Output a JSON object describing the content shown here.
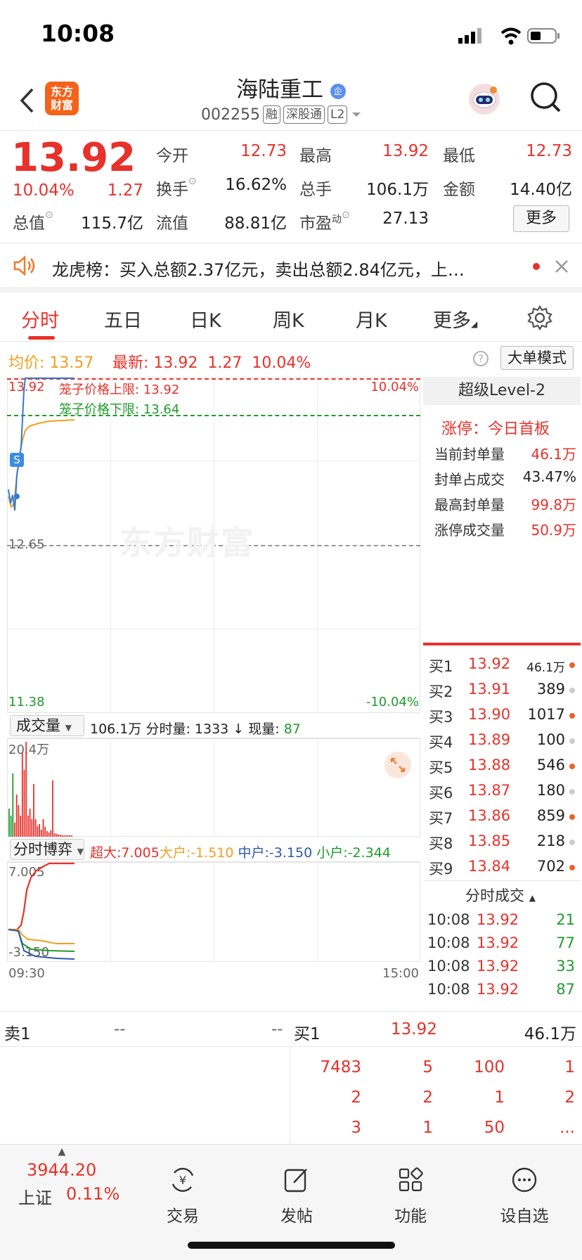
{
  "status_bar": {
    "time": "10:08"
  },
  "header": {
    "logo_text_line1": "东方",
    "logo_text_line2": "财富",
    "stock_name": "海陆重工",
    "stock_name_badge": "企",
    "stock_code": "002255",
    "tags": [
      "融",
      "深股通",
      "L2"
    ]
  },
  "quote": {
    "price": "13.92",
    "change_pct": "10.04%",
    "change_amt": "1.27",
    "fields": {
      "open_label": "今开",
      "open": "12.73",
      "high_label": "最高",
      "high": "13.92",
      "low_label": "最低",
      "low": "12.73",
      "turnover_label": "换手",
      "turnover": "16.62%",
      "volume_label": "总手",
      "volume": "106.1万",
      "amount_label": "金额",
      "amount": "14.40亿",
      "mcap_label": "总值",
      "mcap": "115.7亿",
      "float_label": "流值",
      "float": "88.81亿",
      "pe_label": "市盈",
      "pe_sup": "动",
      "pe": "27.13"
    },
    "more_label": "更多"
  },
  "dragon_tiger": {
    "text": "龙虎榜：买入总额2.37亿元，卖出总额2.84亿元，上…"
  },
  "tabs": [
    "分时",
    "五日",
    "日K",
    "周K",
    "月K",
    "更多"
  ],
  "info_line": {
    "avg_label": "均价:",
    "avg": "13.57",
    "latest_label": "最新:",
    "latest": "13.92",
    "chg": "1.27",
    "pct": "10.04%",
    "mode_button": "大单模式"
  },
  "chart": {
    "upper_price": "13.92",
    "upper_pct": "10.04%",
    "cage_upper": "笼子价格上限: 13.92",
    "cage_lower": "笼子价格下限: 13.64",
    "mid_price": "12.65",
    "lower_price": "11.38",
    "lower_pct": "-10.04%",
    "watermark": "东方财富",
    "s_marker": "S",
    "volume_selector": "成交量",
    "volume_info_total": "106.1万",
    "volume_info_interval_label": "分时量:",
    "volume_info_interval": "1333",
    "volume_info_now_label": "现量:",
    "volume_info_now": "87",
    "volume_axis_max": "20.4万",
    "game_selector": "分时博弈",
    "game_super_label": "超大:",
    "game_super": "7.005",
    "game_big_label": "大户:",
    "game_big": "-1.510",
    "game_mid_label": "中户:",
    "game_mid": "-3.150",
    "game_small_label": "小户:",
    "game_small": "-2.344",
    "game_axis_top": "7.005",
    "game_axis_bottom": "-3.150",
    "time_start": "09:30",
    "time_end": "15:00"
  },
  "level2": {
    "title": "超级Level-2",
    "limit_up_label": "涨停：今日首板",
    "rows": [
      {
        "label": "当前封单量",
        "value": "46.1万"
      },
      {
        "label": "封单占成交",
        "value": "43.47%"
      },
      {
        "label": "最高封单量",
        "value": "99.8万"
      },
      {
        "label": "涨停成交量",
        "value": "50.9万"
      }
    ]
  },
  "bids": [
    {
      "label": "买1",
      "price": "13.92",
      "vol": "46.1万",
      "dot": "#e8632a"
    },
    {
      "label": "买2",
      "price": "13.91",
      "vol": "389",
      "dot": "#cccccc"
    },
    {
      "label": "买3",
      "price": "13.90",
      "vol": "1017",
      "dot": "#e8632a"
    },
    {
      "label": "买4",
      "price": "13.89",
      "vol": "100",
      "dot": "#cccccc"
    },
    {
      "label": "买5",
      "price": "13.88",
      "vol": "546",
      "dot": "#e8632a"
    },
    {
      "label": "买6",
      "price": "13.87",
      "vol": "180",
      "dot": "#cccccc"
    },
    {
      "label": "买7",
      "price": "13.86",
      "vol": "859",
      "dot": "#e8632a"
    },
    {
      "label": "买8",
      "price": "13.85",
      "vol": "218",
      "dot": "#cccccc"
    },
    {
      "label": "买9",
      "price": "13.84",
      "vol": "702",
      "dot": "#e8632a"
    }
  ],
  "ticks_title": "分时成交",
  "ticks": [
    {
      "time": "10:08",
      "price": "13.92",
      "vol": "21"
    },
    {
      "time": "10:08",
      "price": "13.92",
      "vol": "77"
    },
    {
      "time": "10:08",
      "price": "13.92",
      "vol": "33"
    },
    {
      "time": "10:08",
      "price": "13.92",
      "vol": "87"
    }
  ],
  "queue": {
    "sell_label": "卖1",
    "sell_price": "--",
    "sell_vol": "--",
    "buy_label": "买1",
    "buy_price": "13.92",
    "buy_vol": "46.1万",
    "rows": [
      [
        "7483",
        "5",
        "100",
        "1"
      ],
      [
        "2",
        "2",
        "1",
        "2"
      ],
      [
        "3",
        "1",
        "50",
        "..."
      ]
    ]
  },
  "bottom_nav": {
    "index_value": "3944.20",
    "index_name": "上证",
    "index_pct": "0.11%",
    "items": [
      "交易",
      "发帖",
      "功能",
      "设自选"
    ]
  }
}
